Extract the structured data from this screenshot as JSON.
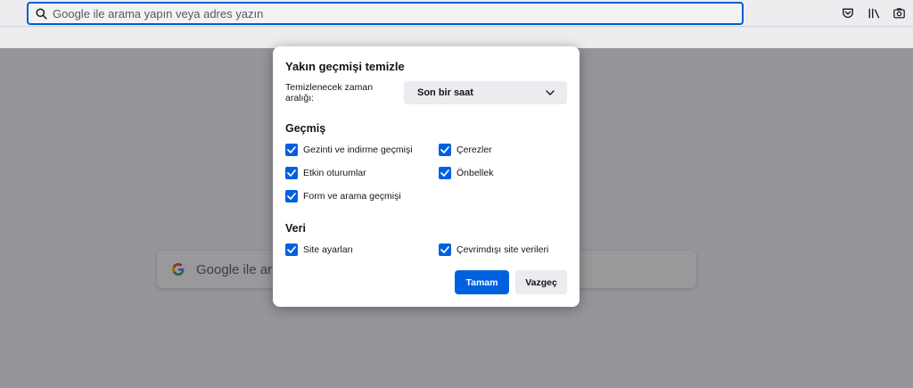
{
  "toolbar": {
    "url_placeholder": "Google ile arama yapın veya adres yazın",
    "icons": [
      "search-icon",
      "pocket-icon",
      "library-icon",
      "screenshot-icon"
    ]
  },
  "newtab": {
    "search_placeholder": "Google ile arama yapın veya adres yazın",
    "search_icon": "google-g-icon"
  },
  "dialog": {
    "title": "Yakın geçmişi temizle",
    "range_label": "Temizlenecek zaman aralığı:",
    "range_value": "Son bir saat",
    "history_title": "Geçmiş",
    "history_items": [
      {
        "label": "Gezinti ve indirme geçmişi",
        "checked": true
      },
      {
        "label": "Çerezler",
        "checked": true
      },
      {
        "label": "Etkin oturumlar",
        "checked": true
      },
      {
        "label": "Önbellek",
        "checked": true
      },
      {
        "label": "Form ve arama geçmişi",
        "checked": true
      }
    ],
    "data_title": "Veri",
    "data_items": [
      {
        "label": "Site ayarları",
        "checked": true
      },
      {
        "label": "Çevrimdışı site verileri",
        "checked": true
      }
    ],
    "ok_label": "Tamam",
    "cancel_label": "Vazgeç"
  },
  "colors": {
    "accent": "#0061e0",
    "urlbar_border": "#0061e0",
    "button_secondary": "#ececf0",
    "overlay": "#1c1b22"
  }
}
